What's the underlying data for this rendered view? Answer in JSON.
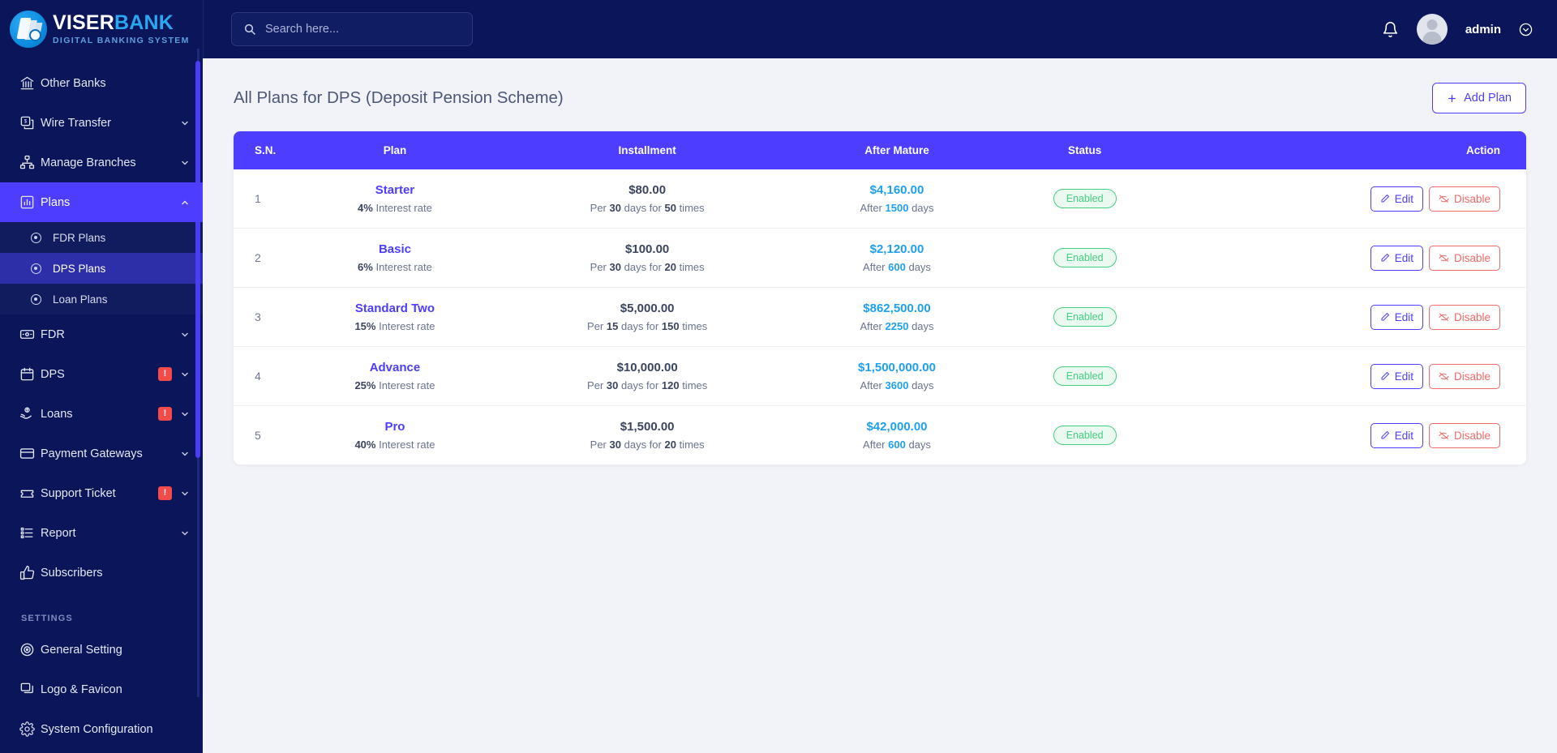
{
  "brand": {
    "name_part1": "VISER",
    "name_part2": "BANK",
    "tagline": "DIGITAL BANKING SYSTEM",
    "accent": "#29a7ef"
  },
  "topbar": {
    "search_placeholder": "Search here...",
    "search_value": "",
    "user_name": "admin"
  },
  "sidebar": {
    "items": [
      {
        "label": "Other Banks",
        "icon": "bank-icon",
        "has_chevron": false,
        "badge": "",
        "active": false
      },
      {
        "label": "Wire Transfer",
        "icon": "wire-transfer-icon",
        "has_chevron": true,
        "badge": "",
        "active": false
      },
      {
        "label": "Manage Branches",
        "icon": "branches-icon",
        "has_chevron": true,
        "badge": "",
        "active": false
      },
      {
        "label": "Plans",
        "icon": "chart-bar-icon",
        "has_chevron": true,
        "badge": "",
        "active": true
      },
      {
        "label": "FDR",
        "icon": "money-icon",
        "has_chevron": true,
        "badge": "",
        "active": false
      },
      {
        "label": "DPS",
        "icon": "calendar-icon",
        "has_chevron": true,
        "badge": "!",
        "active": false
      },
      {
        "label": "Loans",
        "icon": "hand-money-icon",
        "has_chevron": true,
        "badge": "!",
        "active": false
      },
      {
        "label": "Payment Gateways",
        "icon": "credit-card-icon",
        "has_chevron": true,
        "badge": "",
        "active": false
      },
      {
        "label": "Support Ticket",
        "icon": "ticket-icon",
        "has_chevron": true,
        "badge": "!",
        "active": false
      },
      {
        "label": "Report",
        "icon": "list-icon",
        "has_chevron": true,
        "badge": "",
        "active": false
      },
      {
        "label": "Subscribers",
        "icon": "thumbs-up-icon",
        "has_chevron": false,
        "badge": "",
        "active": false
      }
    ],
    "submenu": [
      {
        "label": "FDR Plans",
        "active": false
      },
      {
        "label": "DPS Plans",
        "active": true
      },
      {
        "label": "Loan Plans",
        "active": false
      }
    ],
    "settings_section_label": "SETTINGS",
    "settings_items": [
      {
        "label": "General Setting",
        "icon": "target-icon"
      },
      {
        "label": "Logo & Favicon",
        "icon": "images-icon"
      },
      {
        "label": "System Configuration",
        "icon": "gear-icon"
      }
    ]
  },
  "page": {
    "title": "All Plans for DPS (Deposit Pension Scheme)",
    "add_button_label": "Add Plan"
  },
  "table": {
    "columns": [
      "S.N.",
      "Plan",
      "Installment",
      "After Mature",
      "Status",
      "Action"
    ],
    "rows": [
      {
        "sn": "1",
        "plan_name": "Starter",
        "interest_value": "4%",
        "interest_label": "Interest rate",
        "installment_amount": "$80.00",
        "installment_per_prefix": "Per",
        "installment_days": "30",
        "installment_mid": "days for",
        "installment_times": "50",
        "installment_suffix": "times",
        "mature_amount": "$4,160.00",
        "mature_prefix": "After",
        "mature_days": "1500",
        "mature_suffix": "days",
        "status": "Enabled",
        "edit_label": "Edit",
        "disable_label": "Disable"
      },
      {
        "sn": "2",
        "plan_name": "Basic",
        "interest_value": "6%",
        "interest_label": "Interest rate",
        "installment_amount": "$100.00",
        "installment_per_prefix": "Per",
        "installment_days": "30",
        "installment_mid": "days for",
        "installment_times": "20",
        "installment_suffix": "times",
        "mature_amount": "$2,120.00",
        "mature_prefix": "After",
        "mature_days": "600",
        "mature_suffix": "days",
        "status": "Enabled",
        "edit_label": "Edit",
        "disable_label": "Disable"
      },
      {
        "sn": "3",
        "plan_name": "Standard Two",
        "interest_value": "15%",
        "interest_label": "Interest rate",
        "installment_amount": "$5,000.00",
        "installment_per_prefix": "Per",
        "installment_days": "15",
        "installment_mid": "days for",
        "installment_times": "150",
        "installment_suffix": "times",
        "mature_amount": "$862,500.00",
        "mature_prefix": "After",
        "mature_days": "2250",
        "mature_suffix": "days",
        "status": "Enabled",
        "edit_label": "Edit",
        "disable_label": "Disable"
      },
      {
        "sn": "4",
        "plan_name": "Advance",
        "interest_value": "25%",
        "interest_label": "Interest rate",
        "installment_amount": "$10,000.00",
        "installment_per_prefix": "Per",
        "installment_days": "30",
        "installment_mid": "days for",
        "installment_times": "120",
        "installment_suffix": "times",
        "mature_amount": "$1,500,000.00",
        "mature_prefix": "After",
        "mature_days": "3600",
        "mature_suffix": "days",
        "status": "Enabled",
        "edit_label": "Edit",
        "disable_label": "Disable"
      },
      {
        "sn": "5",
        "plan_name": "Pro",
        "interest_value": "40%",
        "interest_label": "Interest rate",
        "installment_amount": "$1,500.00",
        "installment_per_prefix": "Per",
        "installment_days": "30",
        "installment_mid": "days for",
        "installment_times": "20",
        "installment_suffix": "times",
        "mature_amount": "$42,000.00",
        "mature_prefix": "After",
        "mature_days": "600",
        "mature_suffix": "days",
        "status": "Enabled",
        "edit_label": "Edit",
        "disable_label": "Disable"
      }
    ]
  },
  "colors": {
    "sidebar_bg": "#0b1559",
    "accent_indigo": "#4d3dff",
    "status_green": "#44cf7f",
    "danger_red": "#f06a6a",
    "link_blue": "#1ea0ef",
    "alert_badge": "#f34a4a"
  }
}
